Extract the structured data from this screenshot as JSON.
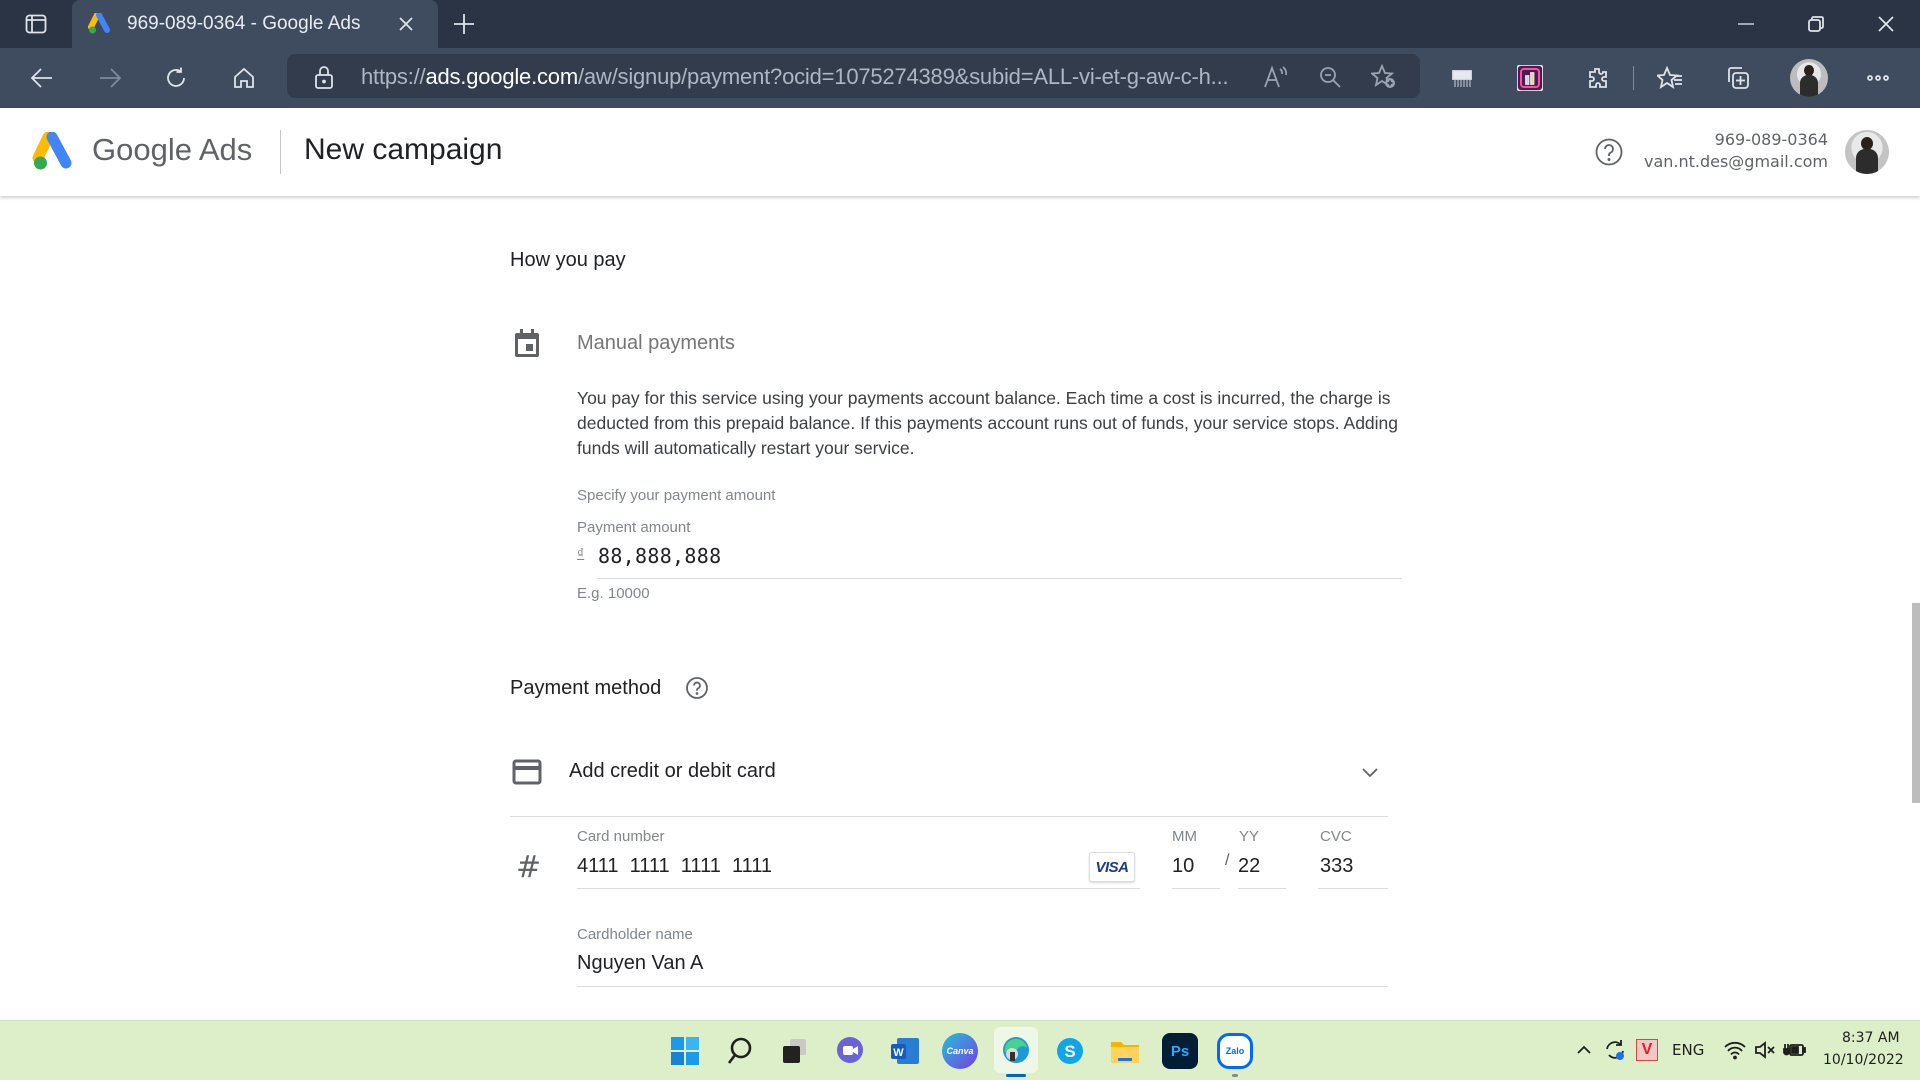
{
  "browser": {
    "tab_title": "969-089-0364 - Google Ads",
    "url_prefix": "https://",
    "url_domain": "ads.google.com",
    "url_path": "/aw/signup/payment?ocid=1075274389&subid=ALL-vi-et-g-aw-c-h...",
    "icons": [
      "tab-actions-icon",
      "google-ads-favicon",
      "close-tab-icon",
      "new-tab-icon",
      "minimize-icon",
      "restore-icon",
      "close-window-icon",
      "back-icon",
      "forward-icon",
      "refresh-icon",
      "home-icon",
      "lock-icon",
      "read-aloud-icon",
      "zoom-out-icon",
      "add-favorite-icon",
      "shredder-extension-icon",
      "analytics-extension-icon",
      "extensions-icon",
      "favorites-icon",
      "collections-icon",
      "profile-avatar",
      "more-menu-icon"
    ]
  },
  "header": {
    "brand": "Google Ads",
    "title": "New campaign",
    "account_phone": "969-089-0364",
    "account_email": "van.nt.des@gmail.com"
  },
  "how_you_pay": {
    "heading": "How you pay",
    "option_title": "Manual payments",
    "description": "You pay for this service using your payments account balance. Each time a cost is incurred, the charge is deducted from this prepaid balance. If this payments account runs out of funds, your service stops. Adding funds will automatically restart your service.",
    "specify_label": "Specify your payment amount",
    "amount_label": "Payment amount",
    "currency_symbol": "₫",
    "amount_value": "88,888,888",
    "amount_hint": "E.g. 10000"
  },
  "payment_method": {
    "heading": "Payment method",
    "add_card_label": "Add credit or debit card",
    "card_number_label": "Card number",
    "card_number_value": "4111  1111  1111  1111",
    "card_brand": "VISA",
    "mm_label": "MM",
    "mm_value": "10",
    "yy_label": "YY",
    "yy_value": "22",
    "separator": "/",
    "cvc_label": "CVC",
    "cvc_value": "333",
    "cardholder_label": "Cardholder name",
    "cardholder_value": "Nguyen Van A"
  },
  "taskbar": {
    "apps": [
      "Start",
      "Search",
      "Task View",
      "Meet",
      "Word",
      "Canva",
      "Edge",
      "Skype",
      "File Explorer",
      "Photoshop",
      "Zalo"
    ],
    "word_label": "W",
    "canva_label": "Canva",
    "skype_label": "S",
    "ps_label": "Ps",
    "zalo_label": "Zalo",
    "language": "ENG",
    "time": "8:37 AM",
    "date": "10/10/2022"
  },
  "colors": {
    "chrome_dark": "#2b3444",
    "chrome_toolbar": "#3f4c60",
    "taskbar_bg": "#dcefc9",
    "ads_blue": "#4285f4",
    "ads_yellow": "#fbbc04",
    "ads_green": "#34a853"
  }
}
